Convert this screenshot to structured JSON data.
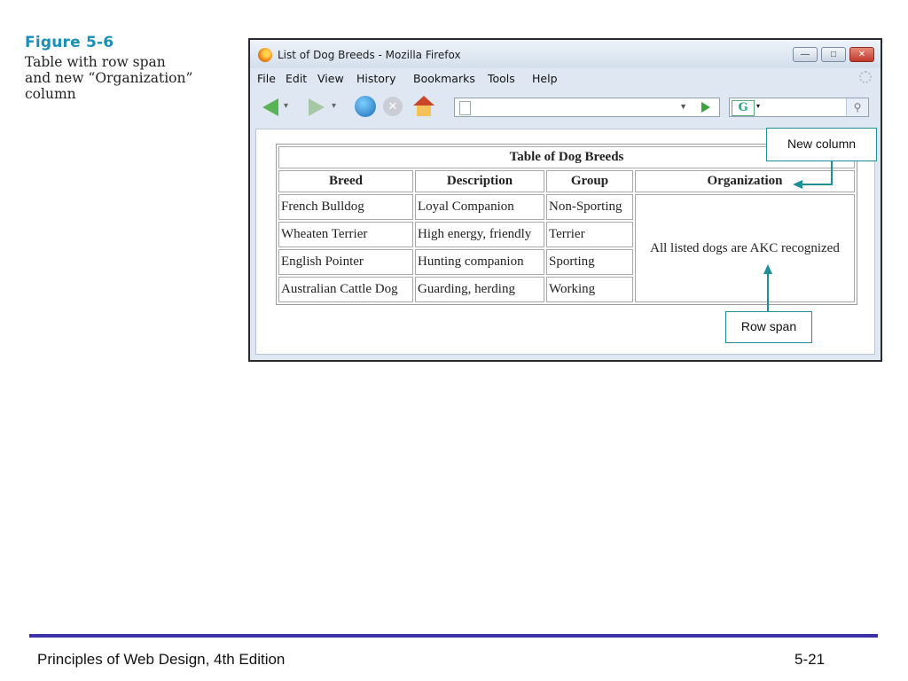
{
  "caption": {
    "figure_label": "Figure 5-6",
    "lines": [
      "Table with row span",
      "and new “Organization”",
      "column"
    ]
  },
  "browser": {
    "window_title": "List of Dog Breeds - Mozilla Firefox",
    "menu": [
      "File",
      "Edit",
      "View",
      "History",
      "Bookmarks",
      "Tools",
      "Help"
    ],
    "window_buttons": [
      "minimize",
      "maximize",
      "close"
    ],
    "url_value": "",
    "search_value": ""
  },
  "table": {
    "title": "Table of Dog Breeds",
    "headers": [
      "Breed",
      "Description",
      "Group",
      "Organization"
    ],
    "rows": [
      [
        "French Bulldog",
        "Loyal Companion",
        "Non-Sporting"
      ],
      [
        "Wheaten Terrier",
        "High energy, friendly",
        "Terrier"
      ],
      [
        "English Pointer",
        "Hunting companion",
        "Sporting"
      ],
      [
        "Australian Cattle Dog",
        "Guarding, herding",
        "Working"
      ]
    ],
    "organization_span": "All listed dogs are AKC recognized"
  },
  "callouts": {
    "new_column": "New column",
    "row_span": "Row span"
  },
  "colors": {
    "figure_label": "#1a8fb8",
    "callout_border": "#1d8f9a",
    "footer_rule": "#3a32a8"
  },
  "footer": {
    "left": "Principles of Web Design, 4th Edition",
    "right": "5-21"
  }
}
